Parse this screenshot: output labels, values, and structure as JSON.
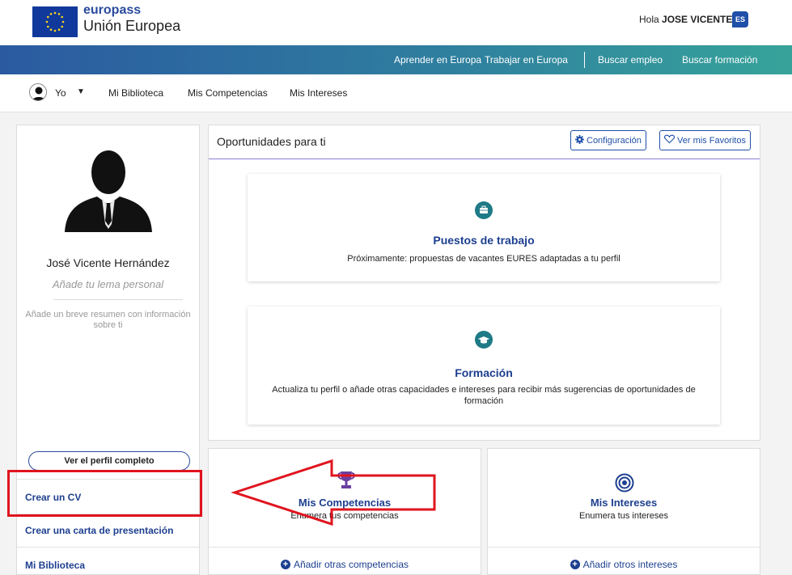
{
  "header": {
    "brand_line1": "europass",
    "brand_line2": "Unión Europea",
    "greeting_prefix": "Hola",
    "user_name": "JOSE VICENTE",
    "language_badge": "ES"
  },
  "main_nav": {
    "items": [
      "Aprender en Europa",
      "Trabajar en Europa",
      "Buscar empleo",
      "Buscar formación"
    ]
  },
  "sub_nav": {
    "user_menu": "Yo",
    "items": [
      "Mi Biblioteca",
      "Mis Competencias",
      "Mis Intereses"
    ]
  },
  "profile": {
    "name": "José Vicente Hernández",
    "motto_placeholder": "Añade tu lema personal",
    "summary_placeholder": "Añade un breve resumen con información sobre ti",
    "view_profile_button": "Ver el perfil completo",
    "menu": [
      "Crear un CV",
      "Crear una carta de presentación",
      "Mi Biblioteca"
    ]
  },
  "opportunities": {
    "title": "Oportunidades para ti",
    "settings_button": "Configuración",
    "favorites_button": "Ver mis Favoritos",
    "jobs": {
      "title": "Puestos de trabajo",
      "text": "Próximamente: propuestas de vacantes EURES adaptadas a tu perfil"
    },
    "training": {
      "title": "Formación",
      "text": "Actualiza tu perfil o añade otras capacidades e intereses para recibir más sugerencias de oportunidades de formación"
    }
  },
  "skills": {
    "title": "Mis Competencias",
    "subtitle": "Enumera tus competencias",
    "action": "Añadir otras competencias"
  },
  "interests": {
    "title": "Mis Intereses",
    "subtitle": "Enumera tus intereses",
    "action": "Añadir otros intereses"
  },
  "colors": {
    "brand_blue": "#1d3f8f",
    "accent_teal": "#1e7a86",
    "skills_icon": "#6b3fa0",
    "annotation_red": "#e0141e"
  }
}
